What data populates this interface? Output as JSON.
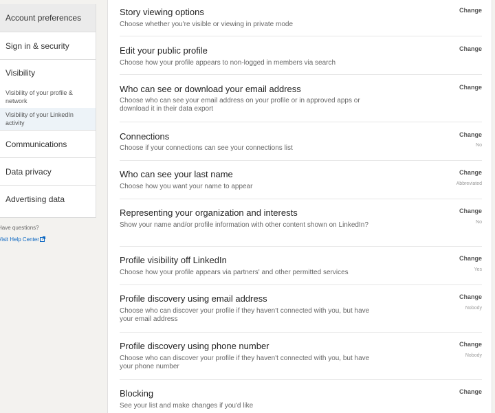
{
  "sidebar": {
    "account_preferences": "Account preferences",
    "sign_in_security": "Sign in & security",
    "visibility": "Visibility",
    "visibility_sub": [
      "Visibility of your profile & network",
      "Visibility of your LinkedIn activity"
    ],
    "communications": "Communications",
    "data_privacy": "Data privacy",
    "advertising_data": "Advertising data",
    "help_question": "Have questions?",
    "help_link": "Visit Help Center"
  },
  "settings": [
    {
      "title": "Story viewing options",
      "desc": "Choose whether you're visible or viewing in private mode",
      "action": "Change",
      "value": ""
    },
    {
      "title": "Edit your public profile",
      "desc": "Choose how your profile appears to non-logged in members via search",
      "action": "Change",
      "value": ""
    },
    {
      "title": "Who can see or download your email address",
      "desc": "Choose who can see your email address on your profile or in approved apps or download it in their data export",
      "action": "Change",
      "value": ""
    },
    {
      "title": "Connections",
      "desc": "Choose if your connections can see your connections list",
      "action": "Change",
      "value": "No"
    },
    {
      "title": "Who can see your last name",
      "desc": "Choose how you want your name to appear",
      "action": "Change",
      "value": "Abbreviated"
    },
    {
      "title": "Representing your organization and interests",
      "desc": "Show your name and/or profile information with other content shown on LinkedIn?",
      "action": "Change",
      "value": "No"
    },
    {
      "title": "Profile visibility off LinkedIn",
      "desc": "Choose how your profile appears via partners' and other permitted services",
      "action": "Change",
      "value": "Yes"
    },
    {
      "title": "Profile discovery using email address",
      "desc": "Choose who can discover your profile if they haven't connected with you, but have your email address",
      "action": "Change",
      "value": "Nobody"
    },
    {
      "title": "Profile discovery using phone number",
      "desc": "Choose who can discover your profile if they haven't connected with you, but have your phone number",
      "action": "Change",
      "value": "Nobody"
    },
    {
      "title": "Blocking",
      "desc": "See your list and make changes if you'd like",
      "action": "Change",
      "value": ""
    }
  ],
  "colors": {
    "accent": "#0a66c2",
    "background": "#f3f2ef"
  }
}
